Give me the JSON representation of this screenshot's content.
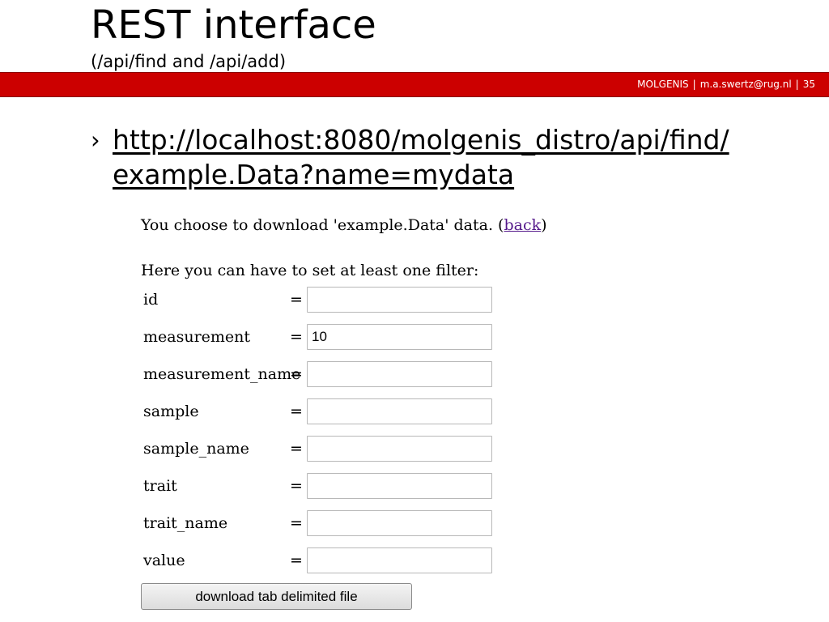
{
  "slide": {
    "title": "REST interface",
    "subtitle": "(/api/find and /api/add)",
    "footer": {
      "org": "MOLGENIS",
      "separator": "|",
      "email": "m.a.swertz@rug.nl",
      "page_number": "35"
    },
    "bullet": {
      "marker": "›",
      "link_line1": "http://localhost:8080/molgenis_distro/api/find/",
      "link_line2": "example.Data?name=mydata"
    }
  },
  "form": {
    "intro_prefix": "You choose to download 'example.Data' data. (",
    "back_link": "back",
    "intro_suffix": ")",
    "filter_hint": "Here you can have to set at least one filter:",
    "equals": "=",
    "fields": [
      {
        "label": "id",
        "value": ""
      },
      {
        "label": "measurement",
        "value": "10"
      },
      {
        "label": "measurement_name",
        "value": ""
      },
      {
        "label": "sample",
        "value": ""
      },
      {
        "label": "sample_name",
        "value": ""
      },
      {
        "label": "trait",
        "value": ""
      },
      {
        "label": "trait_name",
        "value": ""
      },
      {
        "label": "value",
        "value": ""
      }
    ],
    "download_button": "download tab delimited file"
  },
  "colors": {
    "header_bar": "#cc0000",
    "link_visited": "#551a8b"
  }
}
